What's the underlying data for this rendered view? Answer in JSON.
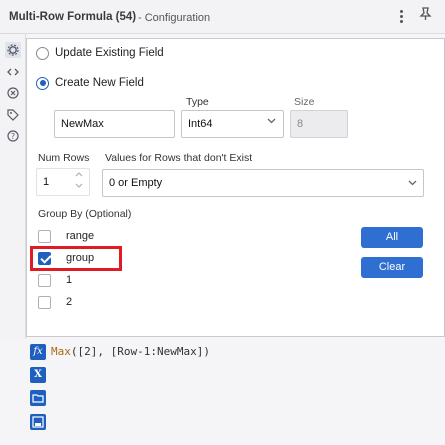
{
  "window": {
    "title": "Multi-Row Formula (54)",
    "subtitle": "- Configuration",
    "menu_icon": "more-vertical-icon",
    "pin_icon": "pin-icon"
  },
  "sidebar": {
    "items": [
      {
        "icon": "gear-icon",
        "active": true
      },
      {
        "icon": "code-icon"
      },
      {
        "icon": "cancel-icon"
      },
      {
        "icon": "tag-icon"
      },
      {
        "icon": "help-icon"
      }
    ]
  },
  "options": {
    "update_label": "Update Existing Field",
    "create_label": "Create New  Field",
    "selected": "create"
  },
  "new_field": {
    "name_value": "NewMax",
    "type_label": "Type",
    "type_value": "Int64",
    "size_label": "Size",
    "size_value": "8"
  },
  "rows": {
    "num_rows_label": "Num Rows",
    "num_rows_value": "1",
    "missing_label": "Values for Rows that don't Exist",
    "missing_value": "0 or Empty"
  },
  "group_by": {
    "title": "Group By (Optional)",
    "items": [
      {
        "label": "range",
        "checked": false
      },
      {
        "label": "group",
        "checked": true
      },
      {
        "label": "1",
        "checked": false
      },
      {
        "label": "2",
        "checked": false
      }
    ],
    "all_label": "All",
    "clear_label": "Clear"
  },
  "formula": {
    "func": "Max",
    "args": "([2], [Row-1:NewMax])"
  },
  "colors": {
    "accent": "#2f6fd1",
    "highlight": "#e01b24"
  }
}
